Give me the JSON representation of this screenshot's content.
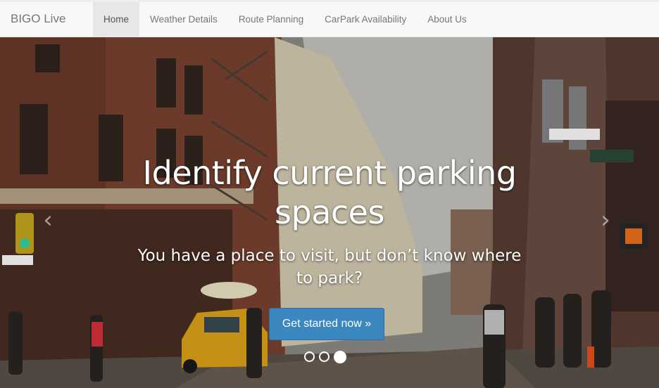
{
  "navbar": {
    "brand": "BIGO Live",
    "items": [
      {
        "label": "Home",
        "active": true
      },
      {
        "label": "Weather Details",
        "active": false
      },
      {
        "label": "Route Planning",
        "active": false
      },
      {
        "label": "CarPark Availability",
        "active": false
      },
      {
        "label": "About Us",
        "active": false
      }
    ]
  },
  "carousel": {
    "heading": "Identify current parking spaces",
    "subheading": "You have a place to visit, but don’t know where to park?",
    "cta_label": "Get started now »",
    "prev_icon": "chevron-left-icon",
    "next_icon": "chevron-right-icon",
    "slide_count": 3,
    "active_slide": 3
  },
  "colors": {
    "cta": "#3b87bf",
    "navbar_bg": "#f8f8f8",
    "active_nav_bg": "#e7e7e7"
  }
}
